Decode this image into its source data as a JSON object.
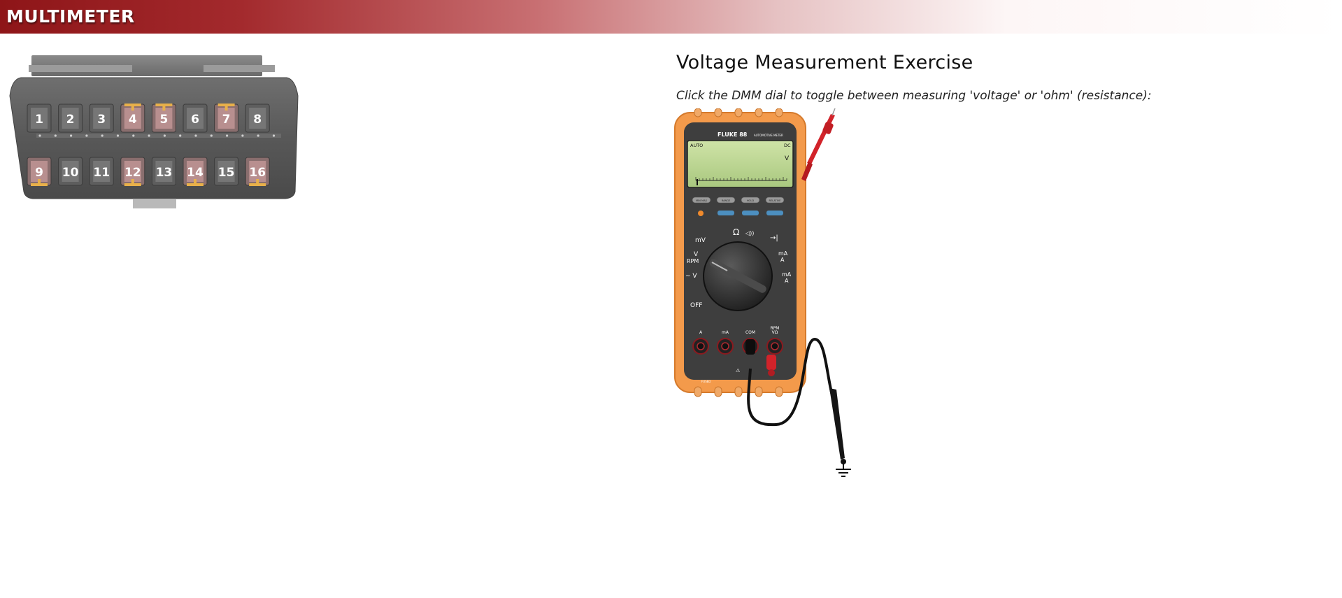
{
  "header": {
    "title": "MULTIMETER"
  },
  "connector": {
    "pins_top": [
      {
        "label": "1",
        "active": false
      },
      {
        "label": "2",
        "active": false
      },
      {
        "label": "3",
        "active": false
      },
      {
        "label": "4",
        "active": true
      },
      {
        "label": "5",
        "active": true
      },
      {
        "label": "6",
        "active": false
      },
      {
        "label": "7",
        "active": true
      },
      {
        "label": "8",
        "active": false
      }
    ],
    "pins_bottom": [
      {
        "label": "9",
        "active": true
      },
      {
        "label": "10",
        "active": false
      },
      {
        "label": "11",
        "active": false
      },
      {
        "label": "12",
        "active": true
      },
      {
        "label": "13",
        "active": false
      },
      {
        "label": "14",
        "active": true
      },
      {
        "label": "15",
        "active": false
      },
      {
        "label": "16",
        "active": true
      }
    ]
  },
  "exercise": {
    "title": "Voltage Measurement Exercise",
    "instruction": "Click the DMM dial to toggle between measuring 'voltage' or 'ohm' (resistance):"
  },
  "multimeter": {
    "brand": "FLUKE 88",
    "model_caption": "AUTOMOTIVE METER",
    "display": {
      "mode": "AUTO",
      "coupling": "DC",
      "unit": "V"
    },
    "buttons": [
      "MIN MAX",
      "RANGE",
      "HOLD",
      "RELATIVE"
    ],
    "dial_labels": {
      "mv": "mV",
      "ohm": "Ω",
      "diode": "→|",
      "v_dc": "V",
      "rpm": "RPM",
      "ma_dc": "mA",
      "a_dc": "A",
      "v_ac": "~ V",
      "ma_ac": "mA",
      "a_ac": "A",
      "off": "OFF"
    },
    "jacks": [
      "A",
      "mA",
      "COM",
      "VΩ",
      "RPM"
    ]
  },
  "colors": {
    "header": "#8e1518",
    "meter_body": "#f39a4b",
    "probe_red": "#d2232a",
    "probe_black": "#111111"
  }
}
